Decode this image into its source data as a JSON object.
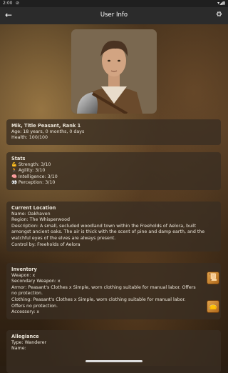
{
  "status_bar": {
    "time": "2:00",
    "indicator": "⊘",
    "icons": "▾◢▮"
  },
  "app_bar": {
    "title": "User Info",
    "back_icon": "←",
    "settings_icon": "⚙"
  },
  "profile": {
    "name_line": "Mik, Title Peasant, Rank 1",
    "age": "Age: 18 years, 0 months, 0 days",
    "health": "Health: 100/100"
  },
  "stats": {
    "heading": "Stats",
    "items": [
      {
        "icon": "💪",
        "text": "Strength: 3/10"
      },
      {
        "icon": "🏃",
        "text": "Agility: 3/10"
      },
      {
        "icon": "🧠",
        "text": "Intelligence: 3/10"
      },
      {
        "icon": "👀",
        "text": "Perception: 3/10"
      }
    ]
  },
  "location": {
    "heading": "Current Location",
    "name": "Name: Oakhaven",
    "region": "Region: The Whisperwood",
    "description": "Description: A small, secluded woodland town within the Freeholds of Aelora, built amongst ancient oaks. The air is thick with the scent of pine and damp earth, and the watchful eyes of the elves are always present.",
    "control": "Control by: Freeholds of Aelora"
  },
  "inventory": {
    "heading": "Inventory",
    "weapon": "Weapon:  x",
    "secondary_weapon": "Secondary Weapon:  x",
    "armor": "Armor: Peasant's Clothes x Simple, worn clothing suitable for manual labor. Offers no protection.",
    "clothing": "Clothing: Peasant's Clothes x Simple, worn clothing suitable for manual labor. Offers no protection.",
    "accessory": "Accessory:  x",
    "icon_scroll": "📜",
    "icon_bag": "👝"
  },
  "allegiance": {
    "heading": "Allegiance",
    "type": "Type: Wanderer",
    "name": "Name:"
  },
  "colors": {
    "card_bg": "#3a2e22",
    "app_bar": "#2b2b2b",
    "status_bar": "#1f1f1f",
    "icon_orange": "#e0a24a"
  }
}
